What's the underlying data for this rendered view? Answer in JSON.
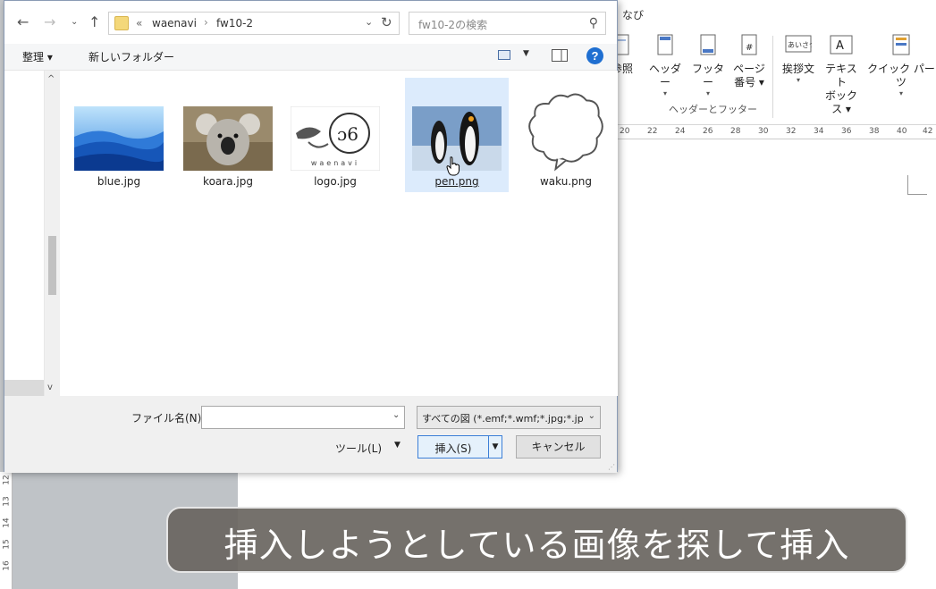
{
  "word": {
    "ribbon_tab_tail": "なび",
    "ribbon_buttons": {
      "shouzou": "参照",
      "header": "ヘッダー",
      "footer": "フッター",
      "page_number_line1": "ページ",
      "page_number_line2": "番号",
      "greeting_line1": "挨拶文",
      "textbox_line1": "テキスト",
      "textbox_line2": "ボックス",
      "quickparts": "クイック パーツ"
    },
    "greeting_icon_text": "あいさつ",
    "group_label": "ヘッダーとフッター",
    "ruler_ticks": [
      "20",
      "22",
      "24",
      "26",
      "28",
      "30",
      "32",
      "34",
      "36",
      "38",
      "40",
      "42"
    ],
    "vertical_ruler_ticks": [
      "12",
      "13",
      "14",
      "15",
      "16"
    ]
  },
  "dialog": {
    "address": {
      "prefix": "«",
      "crumbs": [
        "waenavi",
        "fw10-2"
      ],
      "separator": "›"
    },
    "search_placeholder": "fw10-2の検索",
    "toolbar": {
      "organize": "整理 ▾",
      "new_folder": "新しいフォルダー"
    },
    "help_label": "?",
    "files": [
      {
        "name": "blue.jpg",
        "selected": false
      },
      {
        "name": "koara.jpg",
        "selected": false
      },
      {
        "name": "logo.jpg",
        "selected": false
      },
      {
        "name": "pen.png",
        "selected": true
      },
      {
        "name": "waku.png",
        "selected": false
      }
    ],
    "logo_thumb_text": "waenavi",
    "footer": {
      "filename_label": "ファイル名(N):",
      "filename_value": "",
      "filetype_value": "すべての図 (*.emf;*.wmf;*.jpg;*.jpeg",
      "tools_label": "ツール(L)",
      "insert_label": "挿入(S)",
      "cancel_label": "キャンセル"
    }
  },
  "caption": "挿入しようとしている画像を探して挿入",
  "colors": {
    "accent": "#1f6fd1",
    "selection": "#dcebfc",
    "caption_bg": "#69655f"
  }
}
